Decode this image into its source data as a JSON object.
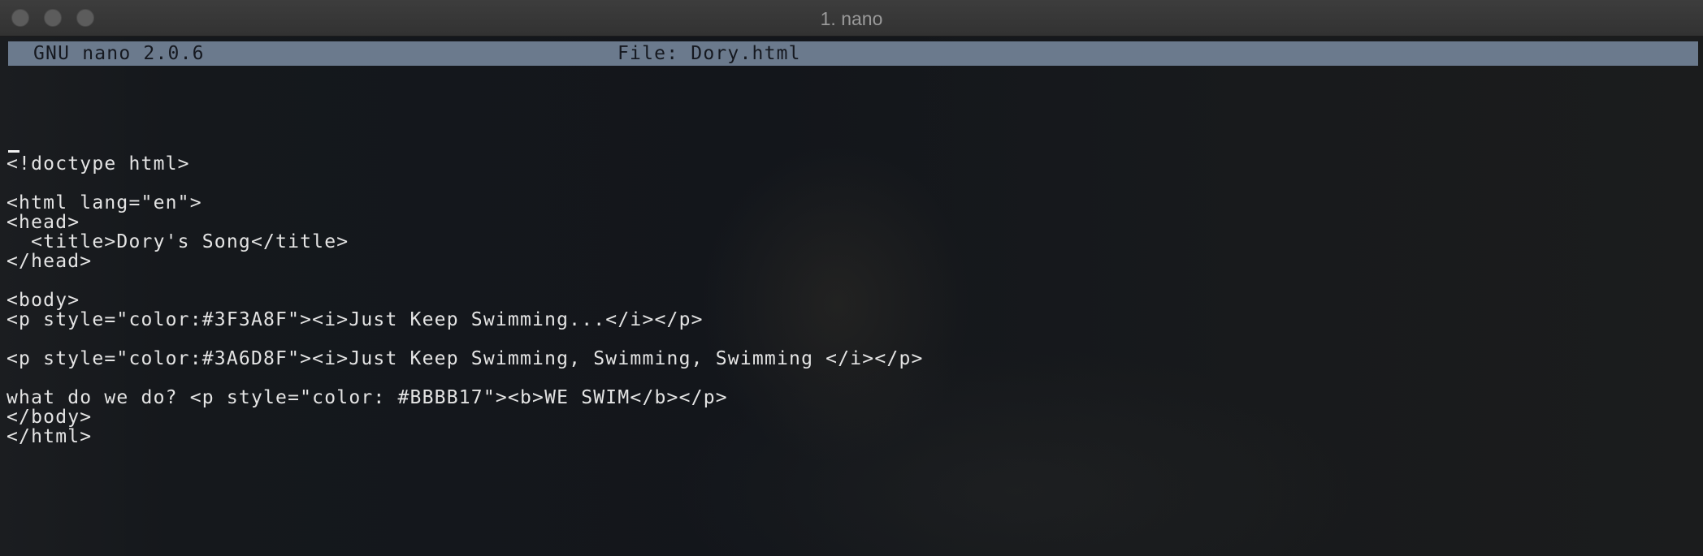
{
  "window": {
    "title": "1. nano"
  },
  "nano": {
    "version_label": "GNU nano 2.0.6",
    "file_label": "File: Dory.html"
  },
  "editor": {
    "lines": [
      "<!doctype html>",
      "",
      "<html lang=\"en\">",
      "<head>",
      "  <title>Dory's Song</title>",
      "</head>",
      "",
      "<body>",
      "<p style=\"color:#3F3A8F\"><i>Just Keep Swimming...</i></p>",
      "",
      "<p style=\"color:#3A6D8F\"><i>Just Keep Swimming, Swimming, Swimming </i></p>",
      "",
      "what do we do? <p style=\"color: #BBBB17\"><b>WE SWIM</b></p>",
      "</body>",
      "</html>"
    ]
  }
}
